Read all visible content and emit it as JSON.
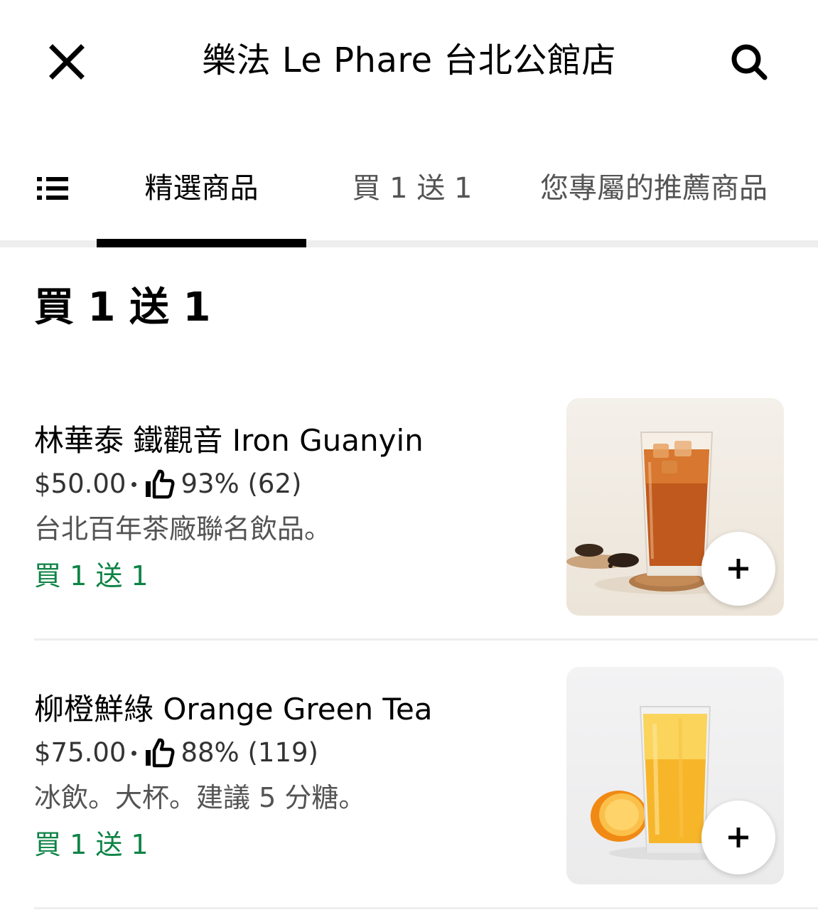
{
  "header": {
    "close_icon": "close-icon",
    "title": "樂法 Le Phare 台北公館店",
    "search_icon": "search-icon"
  },
  "tabs": {
    "menu_icon": "list-menu-icon",
    "items": [
      {
        "label": "精選商品",
        "active": true
      },
      {
        "label": "買 1 送 1",
        "active": false
      },
      {
        "label": "您專屬的推薦商品",
        "active": false
      }
    ]
  },
  "section": {
    "title": "買 1 送 1"
  },
  "items": [
    {
      "name": "林華泰 鐵觀音 Iron Guanyin",
      "price": "$50.00",
      "rating": "93% (62)",
      "description": "台北百年茶廠聯名飲品。",
      "promo": "買 1 送 1",
      "image": "iron-guanyin-tea-photo",
      "add_icon": "plus-icon"
    },
    {
      "name": "柳橙鮮綠 Orange Green Tea",
      "price": "$75.00",
      "rating": "88% (119)",
      "description": "冰飲。大杯。建議 5 分糖。",
      "promo": "買 1 送 1",
      "image": "orange-green-tea-photo",
      "add_icon": "plus-icon"
    }
  ],
  "colors": {
    "promo_green": "#0e8345",
    "secondary_text": "#545454",
    "divider": "#eeeeee",
    "active_tab_underline": "#000000"
  }
}
